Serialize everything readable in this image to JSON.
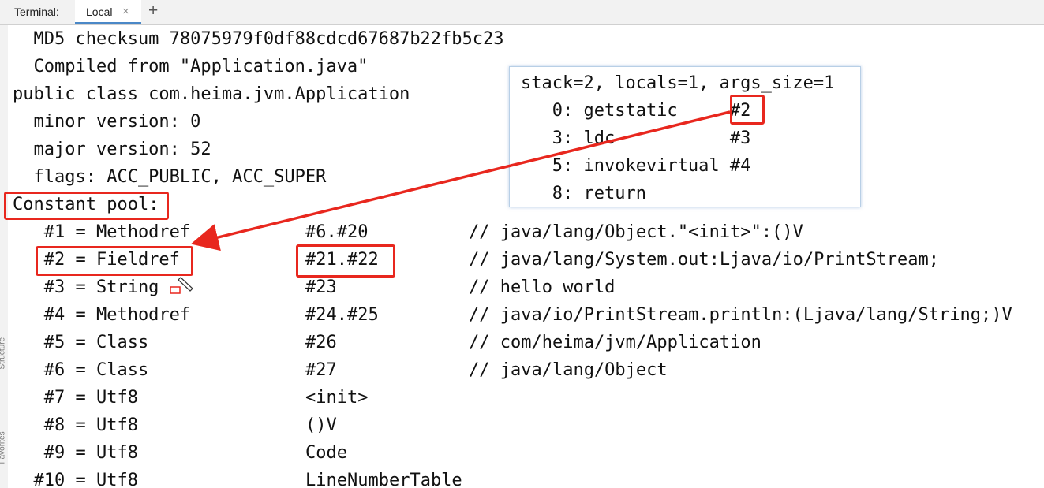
{
  "tabbar": {
    "title": "Terminal:",
    "tab_label": "Local",
    "close_glyph": "×",
    "new_tab_glyph": "+"
  },
  "side_panel": {
    "structure_label": "Structure",
    "favorites_label": "Favorites"
  },
  "header_lines": [
    "  MD5 checksum 78075979f0df88cdcd67687b22fb5c23",
    "  Compiled from \"Application.java\"",
    "public class com.heima.jvm.Application",
    "  minor version: 0",
    "  major version: 52",
    "  flags: ACC_PUBLIC, ACC_SUPER",
    "Constant pool:"
  ],
  "constant_pool": [
    {
      "index": "   #1 = Methodref",
      "ref": "#6.#20",
      "comment": "// java/lang/Object.\"<init>\":()V"
    },
    {
      "index": "   #2 = Fieldref",
      "ref": "#21.#22",
      "comment": "// java/lang/System.out:Ljava/io/PrintStream;"
    },
    {
      "index": "   #3 = String",
      "ref": "#23",
      "comment": "// hello world"
    },
    {
      "index": "   #4 = Methodref",
      "ref": "#24.#25",
      "comment": "// java/io/PrintStream.println:(Ljava/lang/String;)V"
    },
    {
      "index": "   #5 = Class",
      "ref": "#26",
      "comment": "// com/heima/jvm/Application"
    },
    {
      "index": "   #6 = Class",
      "ref": "#27",
      "comment": "// java/lang/Object"
    },
    {
      "index": "   #7 = Utf8",
      "ref": "<init>",
      "comment": ""
    },
    {
      "index": "   #8 = Utf8",
      "ref": "()V",
      "comment": ""
    },
    {
      "index": "   #9 = Utf8",
      "ref": "Code",
      "comment": ""
    },
    {
      "index": "  #10 = Utf8",
      "ref": "LineNumberTable",
      "comment": ""
    }
  ],
  "popup": {
    "lines": [
      "stack=2, locals=1, args_size=1",
      "   0: getstatic     #2",
      "   3: ldc           #3",
      "   5: invokevirtual #4",
      "   8: return"
    ]
  },
  "annotation_color": "#e8271e"
}
